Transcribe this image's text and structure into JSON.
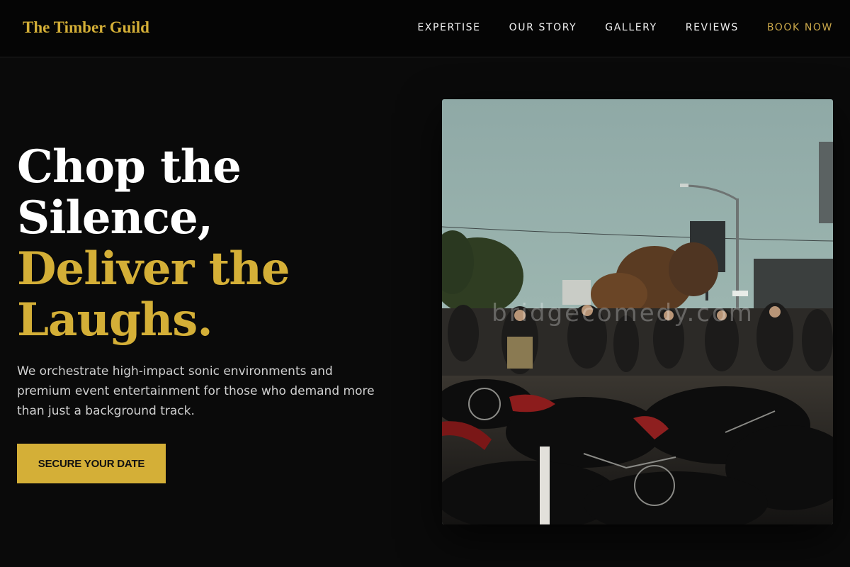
{
  "header": {
    "logo": "The Timber Guild",
    "nav": [
      "EXPERTISE",
      "OUR STORY",
      "GALLERY",
      "REVIEWS"
    ],
    "book_now": "BOOK NOW"
  },
  "hero": {
    "title_line1": "Chop the",
    "title_line2": "Silence,",
    "title_line3": "Deliver the",
    "title_line4": "Laughs.",
    "description": "We orchestrate high-impact sonic environments and premium event entertainment for those who demand more than just a background track.",
    "cta_label": "SECURE YOUR DATE"
  },
  "image": {
    "watermark": "bridgecomedy.com"
  },
  "colors": {
    "accent": "#d4af37",
    "background": "#0a0a0a",
    "header_background": "#050505"
  }
}
